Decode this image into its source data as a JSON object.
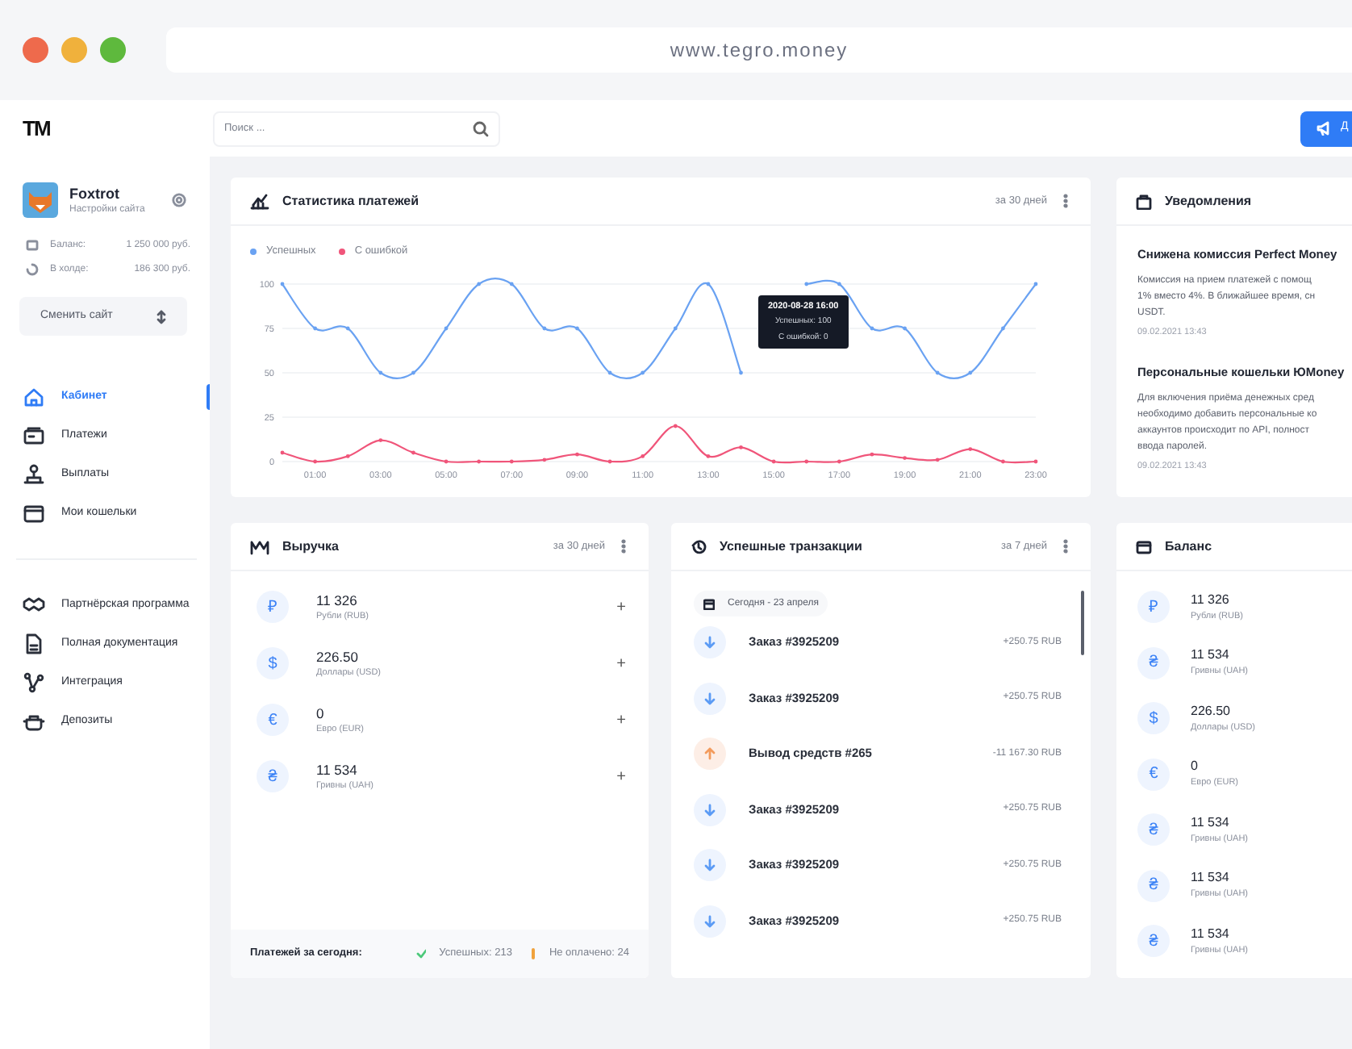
{
  "browser": {
    "url": "www.tegro.money"
  },
  "sidebar": {
    "logo": "TM",
    "profile": {
      "name": "Foxtrot",
      "subtitle": "Настройки сайта"
    },
    "stats": [
      {
        "label": "Баланс:",
        "value": "1 250 000 руб.",
        "kind": "wallet"
      },
      {
        "label": "В холде:",
        "value": "186 300 руб.",
        "kind": "hold"
      }
    ],
    "switch_button": "Сменить сайт",
    "nav": [
      {
        "label": "Кабинет",
        "selected": true,
        "kind": "home"
      },
      {
        "label": "Платежи",
        "selected": false,
        "kind": "payments"
      },
      {
        "label": "Выплаты",
        "selected": false,
        "kind": "payouts"
      },
      {
        "label": "Мои кошельки",
        "selected": false,
        "kind": "wallet"
      }
    ],
    "nav2": [
      {
        "label": "Партнёрская программа",
        "selected": false,
        "kind": "partner"
      },
      {
        "label": "Полная документация",
        "selected": false,
        "kind": "docs"
      },
      {
        "label": "Интеграция",
        "selected": false,
        "kind": "integration"
      },
      {
        "label": "Депозиты",
        "selected": false,
        "kind": "deposit"
      }
    ]
  },
  "header": {
    "search_placeholder": "Поиск ...",
    "button": "Д"
  },
  "stats_card": {
    "title": "Статистика платежей",
    "period": "за 30 дней",
    "chart_data": {
      "type": "line",
      "x": [
        0,
        1,
        2,
        3,
        4,
        5,
        6,
        7,
        8,
        9,
        10,
        11,
        12,
        13,
        14,
        15,
        16,
        17,
        18,
        19,
        20,
        21,
        22,
        23
      ],
      "series": [
        {
          "name": "Успешных",
          "color": "#6aa2f2",
          "values": [
            100,
            75,
            75,
            50,
            50,
            75,
            100,
            100,
            75,
            75,
            50,
            50,
            75,
            100,
            50,
            null,
            100,
            100,
            75,
            75,
            50,
            50,
            75,
            100
          ]
        },
        {
          "name": "С ошибкой",
          "color": "#f0557a",
          "values": [
            5,
            0,
            3,
            12,
            5,
            0,
            0,
            0,
            1,
            4,
            0,
            3,
            20,
            3,
            8,
            0,
            0,
            0,
            4,
            2,
            1,
            7,
            0,
            0
          ]
        }
      ],
      "xlim": [
        0,
        23
      ],
      "ylim": [
        0,
        100
      ],
      "yticks": [
        0,
        25,
        50,
        75,
        100
      ],
      "grid": true,
      "xticks": [
        {
          "value": 1,
          "label": "01:00"
        },
        {
          "value": 3,
          "label": "03:00"
        },
        {
          "value": 5,
          "label": "05:00"
        },
        {
          "value": 7,
          "label": "07:00"
        },
        {
          "value": 9,
          "label": "09:00"
        },
        {
          "value": 11,
          "label": "11:00"
        },
        {
          "value": 13,
          "label": "13:00"
        },
        {
          "value": 15,
          "label": "15:00"
        },
        {
          "value": 17,
          "label": "17:00"
        },
        {
          "value": 19,
          "label": "19:00"
        },
        {
          "value": 21,
          "label": "21:00"
        },
        {
          "value": 23,
          "label": "23:00"
        }
      ]
    },
    "tooltip": {
      "title": "2020-08-28 16:00",
      "lines": [
        "Успешных: 100",
        "С ошибкой: 0"
      ]
    }
  },
  "notifications": {
    "title": "Уведомления",
    "items": [
      {
        "title": "Снижена комиссия Perfect Money",
        "lines": [
          "Комиссия на прием платежей с помощ",
          "1% вместо 4%. В ближайшее время, сн",
          "USDT."
        ],
        "date": "09.02.2021 13:43"
      },
      {
        "title": "Персональные кошельки ЮMoney",
        "lines": [
          "Для включения приёма денежных сред",
          "необходимо добавить персональные ко",
          "аккаунтов происходит по API, полност",
          "ввода паролей."
        ],
        "date": "09.02.2021 13:43"
      }
    ]
  },
  "revenue": {
    "title": "Выручка",
    "period": "за 30 дней",
    "rows": [
      {
        "symbol": "₽",
        "amount": "11 326",
        "currency": "Рубли (RUB)",
        "action": "+"
      },
      {
        "symbol": "$",
        "amount": "226.50",
        "currency": "Доллары (USD)",
        "action": "+"
      },
      {
        "symbol": "€",
        "amount": "0",
        "currency": "Евро  (EUR)",
        "action": "+"
      },
      {
        "symbol": "₴",
        "amount": "11 534",
        "currency": "Гривны (UAH)",
        "action": "+"
      }
    ],
    "footer": {
      "label": "Платежей за сегодня:",
      "success": "Успешных: 213",
      "unpaid": "Не оплачено: 24"
    }
  },
  "transactions": {
    "title": "Успешные транзакции",
    "period": "за 7 дней",
    "date_chip": "Сегодня - 23 апреля",
    "rows": [
      {
        "kind": "in",
        "title": "Заказ #3925209",
        "amount": "+250.75 RUB"
      },
      {
        "kind": "in",
        "title": "Заказ #3925209",
        "amount": "+250.75 RUB"
      },
      {
        "kind": "out",
        "title": "Вывод средств #265",
        "amount": "-11 167.30 RUB"
      },
      {
        "kind": "in",
        "title": "Заказ #3925209",
        "amount": "+250.75 RUB"
      },
      {
        "kind": "in",
        "title": "Заказ #3925209",
        "amount": "+250.75 RUB"
      },
      {
        "kind": "in",
        "title": "Заказ #3925209",
        "amount": "+250.75 RUB"
      }
    ]
  },
  "balance": {
    "title": "Баланс",
    "rows": [
      {
        "symbol": "₽",
        "amount": "11 326",
        "currency": "Рубли (RUB)"
      },
      {
        "symbol": "₴",
        "amount": "11 534",
        "currency": "Гривны (UAH)"
      },
      {
        "symbol": "$",
        "amount": "226.50",
        "currency": "Доллары (USD)"
      },
      {
        "symbol": "€",
        "amount": "0",
        "currency": "Евро (EUR)"
      },
      {
        "symbol": "₴",
        "amount": "11 534",
        "currency": "Гривны (UAH)"
      },
      {
        "symbol": "₴",
        "amount": "11 534",
        "currency": "Гривны (UAH)"
      },
      {
        "symbol": "₴",
        "amount": "11 534",
        "currency": "Гривны (UAH)"
      }
    ]
  }
}
